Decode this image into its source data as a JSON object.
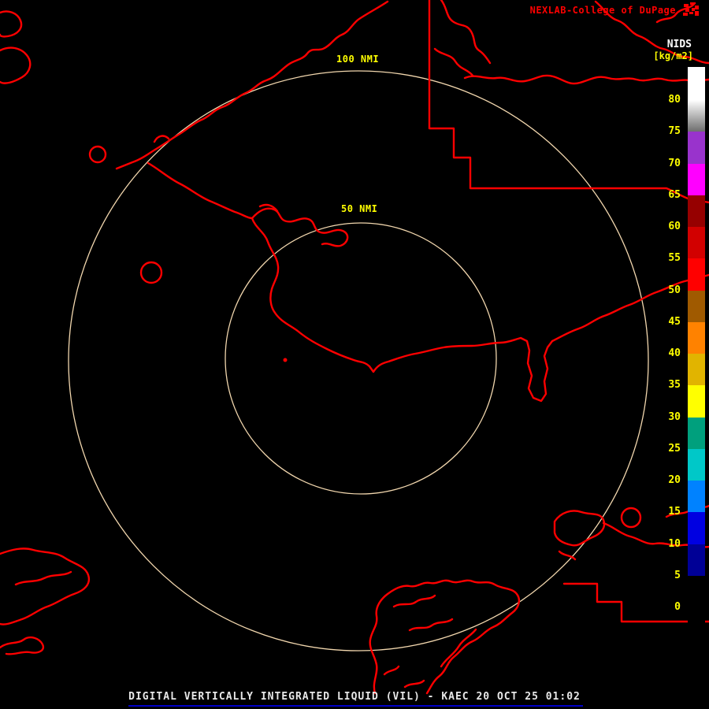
{
  "header": {
    "brand": "NEXLAB-College of DuPage",
    "logo_icon": "nexlab-logo-icon"
  },
  "colorbar": {
    "title": "NIDS",
    "units": "[kg/m2]",
    "ticks": [
      "80",
      "75",
      "70",
      "65",
      "60",
      "55",
      "50",
      "45",
      "40",
      "35",
      "30",
      "25",
      "20",
      "15",
      "10",
      "5",
      "0"
    ],
    "segments": [
      {
        "range": ">80",
        "color": "#ffffff"
      },
      {
        "range": "75-80",
        "gradient": [
          "#ffffff",
          "#6e6e6e"
        ]
      },
      {
        "range": "70-75",
        "color": "#9933cc"
      },
      {
        "range": "65-70",
        "color": "#ff00ff"
      },
      {
        "range": "60-65",
        "color": "#960000"
      },
      {
        "range": "55-60",
        "color": "#d20000"
      },
      {
        "range": "50-55",
        "color": "#ff0000"
      },
      {
        "range": "45-50",
        "color": "#a05a00"
      },
      {
        "range": "40-45",
        "color": "#ff8200"
      },
      {
        "range": "35-40",
        "color": "#e1b400"
      },
      {
        "range": "30-35",
        "color": "#ffff00"
      },
      {
        "range": "25-30",
        "color": "#00a07d"
      },
      {
        "range": "20-25",
        "color": "#00c8c8"
      },
      {
        "range": "15-20",
        "color": "#0082ff"
      },
      {
        "range": "10-15",
        "color": "#0000e1"
      },
      {
        "range": "5-10",
        "color": "#000096"
      },
      {
        "range": "0-5",
        "color": "#000000"
      }
    ]
  },
  "map": {
    "range_rings": [
      {
        "label": "100 NMI",
        "radius_nmi": 100
      },
      {
        "label": "50 NMI",
        "radius_nmi": 50
      }
    ]
  },
  "footer": {
    "title": "DIGITAL VERTICALLY INTEGRATED LIQUID (VIL) - KAEC 20 OCT 25 01:02",
    "product": "DIGITAL VERTICALLY INTEGRATED LIQUID (VIL)",
    "station": "KAEC",
    "datetime": "20 OCT 25 01:02"
  },
  "colors": {
    "background": "#000000",
    "map_boundary": "#ff0000",
    "range_ring": "#f2d7ae",
    "label_yellow": "#ffff00",
    "text_white": "#ffffff",
    "brand_red": "#ff0000",
    "footer_rule_blue": "#0000c8"
  }
}
